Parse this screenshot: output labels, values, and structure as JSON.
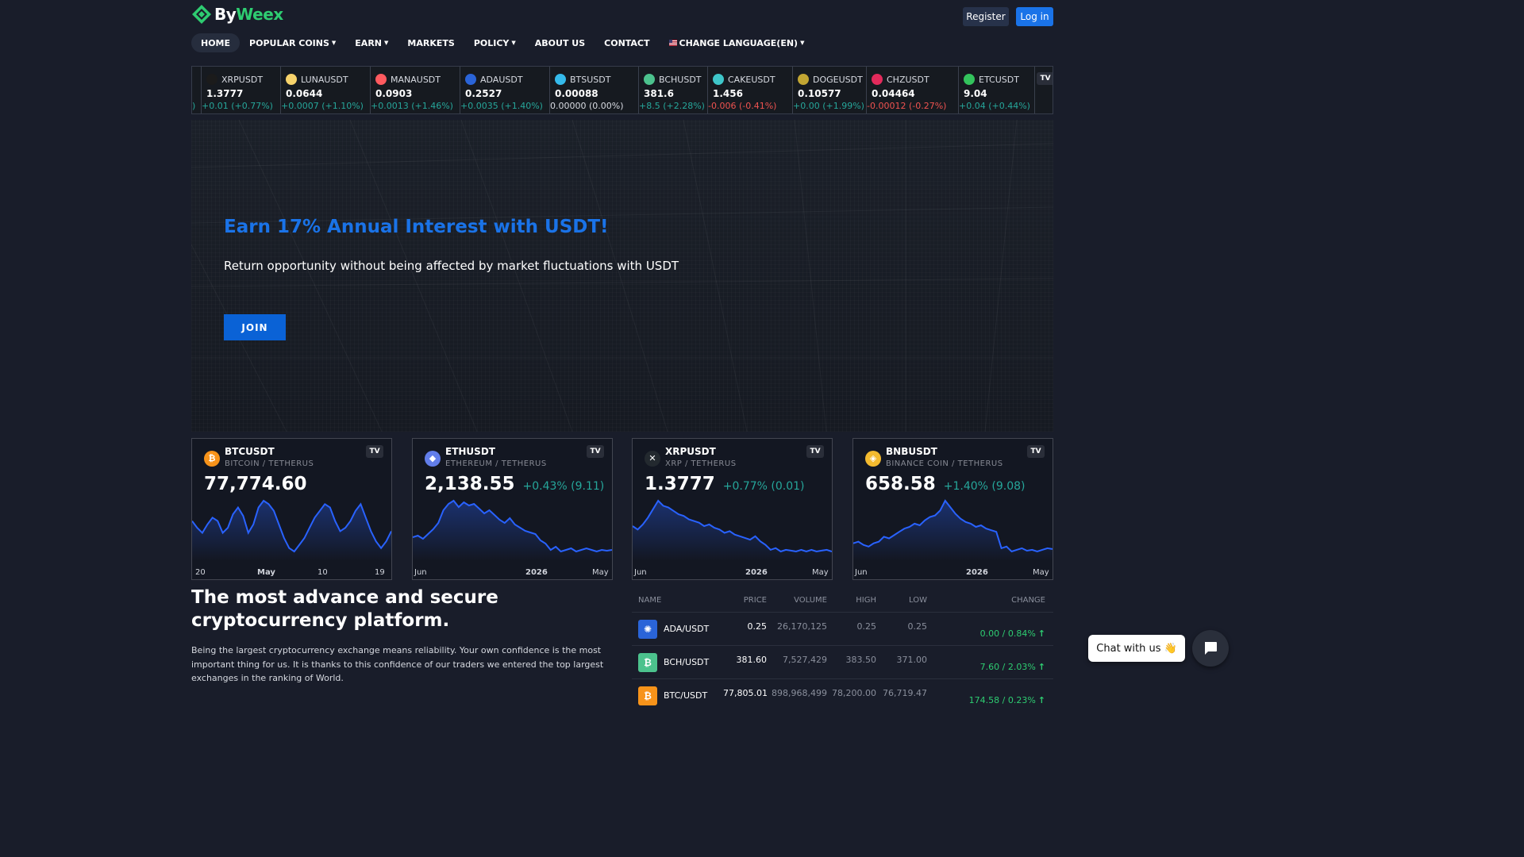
{
  "header": {
    "logo_by": "By",
    "logo_weex": "Weex",
    "register_label": "Register",
    "login_label": "Log in"
  },
  "nav": {
    "home": "HOME",
    "popular_coins": "POPULAR COINS",
    "earn": "EARN",
    "markets": "MARKETS",
    "policy": "POLICY",
    "about": "ABOUT US",
    "contact": "CONTACT",
    "language": "CHANGE LANGUAGE(EN)"
  },
  "ticker": [
    {
      "symbol": "XRPUSDT",
      "price": "1.3777",
      "change": "+0.01 (+0.77%)",
      "dir": "up",
      "color": "#1b1b1b",
      "icon": "x-icon"
    },
    {
      "symbol": "LUNAUSDT",
      "price": "0.0644",
      "change": "+0.0007 (+1.10%)",
      "dir": "up",
      "color": "#f7d36b",
      "icon": "luna-icon"
    },
    {
      "symbol": "MANAUSDT",
      "price": "0.0903",
      "change": "+0.0013 (+1.46%)",
      "dir": "up",
      "color": "#ff5a5f",
      "icon": "mana-icon"
    },
    {
      "symbol": "ADAUSDT",
      "price": "0.2527",
      "change": "+0.0035 (+1.40%)",
      "dir": "up",
      "color": "#2a64d8",
      "icon": "ada-icon"
    },
    {
      "symbol": "BTSUSDT",
      "price": "0.00088",
      "change": "0.00000 (0.00%)",
      "dir": "flat",
      "color": "#35baeb",
      "icon": "bts-icon"
    },
    {
      "symbol": "BCHUSDT",
      "price": "381.6",
      "change": "+8.5 (+2.28%)",
      "dir": "up",
      "color": "#4cc28d",
      "icon": "bch-icon"
    },
    {
      "symbol": "CAKEUSDT",
      "price": "1.456",
      "change": "-0.006 (-0.41%)",
      "dir": "down",
      "color": "#3ec6c9",
      "icon": "cake-icon"
    },
    {
      "symbol": "DOGEUSDT",
      "price": "0.10577",
      "change": "+0.00 (+1.99%)",
      "dir": "up",
      "color": "#c2a633",
      "icon": "doge-icon"
    },
    {
      "symbol": "CHZUSDT",
      "price": "0.04464",
      "change": "-0.00012 (-0.27%)",
      "dir": "down",
      "color": "#e22a5b",
      "icon": "chz-icon"
    },
    {
      "symbol": "ETCUSDT",
      "price": "9.04",
      "change": "+0.04 (+0.44%)",
      "dir": "up",
      "color": "#33c35c",
      "icon": "etc-icon"
    }
  ],
  "ticker_cut_prefix": ")",
  "hero": {
    "title": "Earn 17% Annual Interest with USDT!",
    "subtitle": "Return opportunity without being affected by market fluctuations with USDT",
    "join_label": "JOIN"
  },
  "cards": [
    {
      "symbol": "BTCUSDT",
      "name": "BITCOIN / TETHERUS",
      "price": "77,774.60",
      "change": "",
      "icon_color": "#f7931a",
      "icon": "bitcoin-icon",
      "axis": [
        "20",
        "May",
        "10",
        "19"
      ],
      "series": [
        62,
        58,
        55,
        60,
        64,
        62,
        55,
        58,
        66,
        70,
        65,
        55,
        60,
        70,
        74,
        72,
        68,
        60,
        52,
        46,
        44,
        48,
        52,
        58,
        64,
        68,
        72,
        70,
        62,
        56,
        58,
        62,
        68,
        72,
        64,
        56,
        50,
        46,
        50,
        56
      ]
    },
    {
      "symbol": "ETHUSDT",
      "name": "ETHEREUM / TETHERUS",
      "price": "2,138.55",
      "change": "+0.43% (9.11)",
      "icon_color": "#627eea",
      "icon": "ethereum-icon",
      "axis": [
        "Jun",
        "2026",
        "May"
      ],
      "series": [
        28,
        30,
        26,
        32,
        38,
        46,
        62,
        70,
        74,
        66,
        72,
        68,
        70,
        64,
        58,
        62,
        56,
        50,
        46,
        52,
        44,
        40,
        36,
        34,
        32,
        24,
        20,
        12,
        16,
        10,
        12,
        14,
        10,
        12,
        14,
        12,
        10,
        12,
        11,
        12
      ]
    },
    {
      "symbol": "XRPUSDT",
      "name": "XRP / TETHERUS",
      "price": "1.3777",
      "change": "+0.77% (0.01)",
      "icon_color": "#23292f",
      "icon": "xrp-icon",
      "axis": [
        "Jun",
        "2026",
        "May"
      ],
      "series": [
        40,
        36,
        42,
        50,
        60,
        70,
        64,
        62,
        58,
        54,
        52,
        48,
        46,
        44,
        40,
        42,
        38,
        36,
        32,
        34,
        30,
        28,
        26,
        24,
        28,
        22,
        18,
        12,
        14,
        10,
        12,
        11,
        10,
        12,
        10,
        12,
        10,
        11,
        12,
        10
      ]
    },
    {
      "symbol": "BNBUSDT",
      "name": "BINANCE COIN / TETHERUS",
      "price": "658.58",
      "change": "+1.40% (9.08)",
      "icon_color": "#f3ba2f",
      "icon": "bnb-icon",
      "axis": [
        "Jun",
        "2026",
        "May"
      ],
      "series": [
        20,
        22,
        18,
        16,
        20,
        22,
        28,
        26,
        30,
        34,
        38,
        40,
        44,
        42,
        48,
        52,
        54,
        60,
        72,
        64,
        56,
        50,
        46,
        44,
        40,
        42,
        38,
        36,
        34,
        14,
        16,
        10,
        12,
        14,
        11,
        12,
        10,
        12,
        14,
        13
      ]
    }
  ],
  "about": {
    "title": "The most advance and secure cryptocurrency platform.",
    "text": "Being the largest cryptocurrency exchange means reliability. Your own confidence is the most important thing for us. It is thanks to this confidence of our traders we entered the top largest exchanges in the ranking of World."
  },
  "market_table": {
    "headers": {
      "name": "NAME",
      "price": "PRICE",
      "volume": "VOLUME",
      "high": "HIGH",
      "low": "LOW",
      "change": "CHANGE"
    },
    "rows": [
      {
        "pair": "ADA/USDT",
        "price": "0.25",
        "volume": "26,170,125",
        "high": "0.25",
        "low": "0.25",
        "change": "0.00 / 0.84%",
        "color": "#2a64d8",
        "icon": "ada-icon"
      },
      {
        "pair": "BCH/USDT",
        "price": "381.60",
        "volume": "7,527,429",
        "high": "383.50",
        "low": "371.00",
        "change": "7.60 / 2.03%",
        "color": "#4cc28d",
        "icon": "bch-icon"
      },
      {
        "pair": "BTC/USDT",
        "price": "77,805.01",
        "volume": "898,968,499",
        "high": "78,200.00",
        "low": "76,719.47",
        "change": "174.58 / 0.23%",
        "color": "#f7931a",
        "icon": "bitcoin-icon"
      }
    ]
  },
  "chat": {
    "label": "Chat with us"
  }
}
